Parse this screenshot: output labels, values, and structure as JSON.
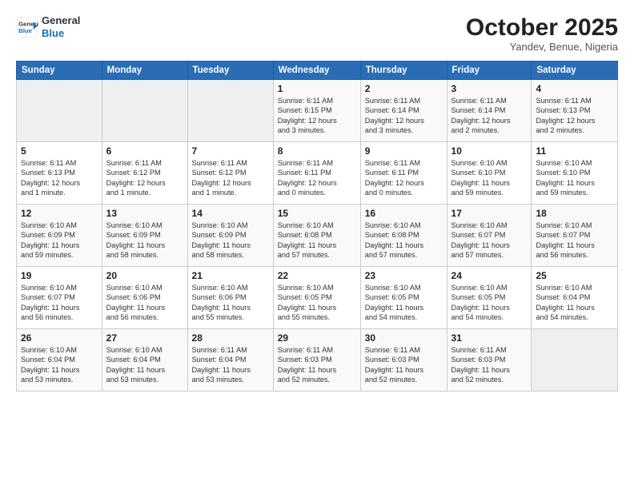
{
  "header": {
    "logo_line1": "General",
    "logo_line2": "Blue",
    "month": "October 2025",
    "location": "Yandev, Benue, Nigeria"
  },
  "weekdays": [
    "Sunday",
    "Monday",
    "Tuesday",
    "Wednesday",
    "Thursday",
    "Friday",
    "Saturday"
  ],
  "weeks": [
    [
      {
        "day": "",
        "info": ""
      },
      {
        "day": "",
        "info": ""
      },
      {
        "day": "",
        "info": ""
      },
      {
        "day": "1",
        "info": "Sunrise: 6:11 AM\nSunset: 6:15 PM\nDaylight: 12 hours\nand 3 minutes."
      },
      {
        "day": "2",
        "info": "Sunrise: 6:11 AM\nSunset: 6:14 PM\nDaylight: 12 hours\nand 3 minutes."
      },
      {
        "day": "3",
        "info": "Sunrise: 6:11 AM\nSunset: 6:14 PM\nDaylight: 12 hours\nand 2 minutes."
      },
      {
        "day": "4",
        "info": "Sunrise: 6:11 AM\nSunset: 6:13 PM\nDaylight: 12 hours\nand 2 minutes."
      }
    ],
    [
      {
        "day": "5",
        "info": "Sunrise: 6:11 AM\nSunset: 6:13 PM\nDaylight: 12 hours\nand 1 minute."
      },
      {
        "day": "6",
        "info": "Sunrise: 6:11 AM\nSunset: 6:12 PM\nDaylight: 12 hours\nand 1 minute."
      },
      {
        "day": "7",
        "info": "Sunrise: 6:11 AM\nSunset: 6:12 PM\nDaylight: 12 hours\nand 1 minute."
      },
      {
        "day": "8",
        "info": "Sunrise: 6:11 AM\nSunset: 6:11 PM\nDaylight: 12 hours\nand 0 minutes."
      },
      {
        "day": "9",
        "info": "Sunrise: 6:11 AM\nSunset: 6:11 PM\nDaylight: 12 hours\nand 0 minutes."
      },
      {
        "day": "10",
        "info": "Sunrise: 6:10 AM\nSunset: 6:10 PM\nDaylight: 11 hours\nand 59 minutes."
      },
      {
        "day": "11",
        "info": "Sunrise: 6:10 AM\nSunset: 6:10 PM\nDaylight: 11 hours\nand 59 minutes."
      }
    ],
    [
      {
        "day": "12",
        "info": "Sunrise: 6:10 AM\nSunset: 6:09 PM\nDaylight: 11 hours\nand 59 minutes."
      },
      {
        "day": "13",
        "info": "Sunrise: 6:10 AM\nSunset: 6:09 PM\nDaylight: 11 hours\nand 58 minutes."
      },
      {
        "day": "14",
        "info": "Sunrise: 6:10 AM\nSunset: 6:09 PM\nDaylight: 11 hours\nand 58 minutes."
      },
      {
        "day": "15",
        "info": "Sunrise: 6:10 AM\nSunset: 6:08 PM\nDaylight: 11 hours\nand 57 minutes."
      },
      {
        "day": "16",
        "info": "Sunrise: 6:10 AM\nSunset: 6:08 PM\nDaylight: 11 hours\nand 57 minutes."
      },
      {
        "day": "17",
        "info": "Sunrise: 6:10 AM\nSunset: 6:07 PM\nDaylight: 11 hours\nand 57 minutes."
      },
      {
        "day": "18",
        "info": "Sunrise: 6:10 AM\nSunset: 6:07 PM\nDaylight: 11 hours\nand 56 minutes."
      }
    ],
    [
      {
        "day": "19",
        "info": "Sunrise: 6:10 AM\nSunset: 6:07 PM\nDaylight: 11 hours\nand 56 minutes."
      },
      {
        "day": "20",
        "info": "Sunrise: 6:10 AM\nSunset: 6:06 PM\nDaylight: 11 hours\nand 56 minutes."
      },
      {
        "day": "21",
        "info": "Sunrise: 6:10 AM\nSunset: 6:06 PM\nDaylight: 11 hours\nand 55 minutes."
      },
      {
        "day": "22",
        "info": "Sunrise: 6:10 AM\nSunset: 6:05 PM\nDaylight: 11 hours\nand 55 minutes."
      },
      {
        "day": "23",
        "info": "Sunrise: 6:10 AM\nSunset: 6:05 PM\nDaylight: 11 hours\nand 54 minutes."
      },
      {
        "day": "24",
        "info": "Sunrise: 6:10 AM\nSunset: 6:05 PM\nDaylight: 11 hours\nand 54 minutes."
      },
      {
        "day": "25",
        "info": "Sunrise: 6:10 AM\nSunset: 6:04 PM\nDaylight: 11 hours\nand 54 minutes."
      }
    ],
    [
      {
        "day": "26",
        "info": "Sunrise: 6:10 AM\nSunset: 6:04 PM\nDaylight: 11 hours\nand 53 minutes."
      },
      {
        "day": "27",
        "info": "Sunrise: 6:10 AM\nSunset: 6:04 PM\nDaylight: 11 hours\nand 53 minutes."
      },
      {
        "day": "28",
        "info": "Sunrise: 6:11 AM\nSunset: 6:04 PM\nDaylight: 11 hours\nand 53 minutes."
      },
      {
        "day": "29",
        "info": "Sunrise: 6:11 AM\nSunset: 6:03 PM\nDaylight: 11 hours\nand 52 minutes."
      },
      {
        "day": "30",
        "info": "Sunrise: 6:11 AM\nSunset: 6:03 PM\nDaylight: 11 hours\nand 52 minutes."
      },
      {
        "day": "31",
        "info": "Sunrise: 6:11 AM\nSunset: 6:03 PM\nDaylight: 11 hours\nand 52 minutes."
      },
      {
        "day": "",
        "info": ""
      }
    ]
  ]
}
